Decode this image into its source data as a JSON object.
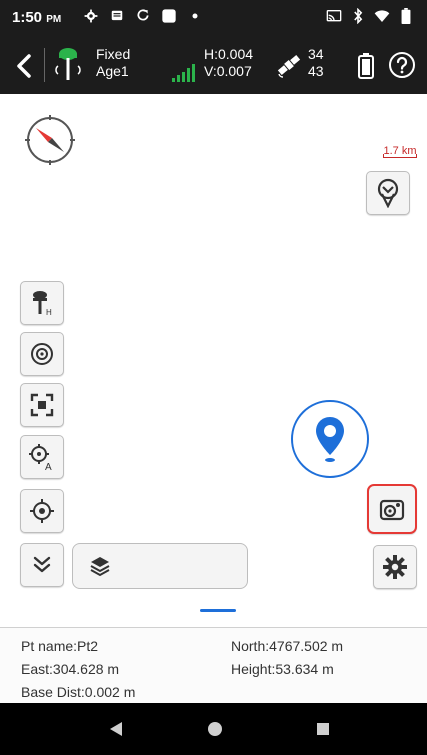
{
  "status_bar": {
    "time": "1:50",
    "ampm": "PM",
    "left_icons": [
      "settings-icon",
      "message-icon",
      "sync-icon",
      "app-square-icon",
      "notification-dot-icon"
    ],
    "right_icons": [
      "cast-icon",
      "bluetooth-icon",
      "wifi-icon",
      "battery-icon"
    ]
  },
  "toolbar": {
    "fix_status": "Fixed",
    "age": "Age1",
    "h_precision": "H:0.004",
    "v_precision": "V:0.007",
    "sat_used": "34",
    "sat_visible": "43",
    "colors": {
      "gnss_icon": "#2bb34b",
      "signal_bars": "#2bb34b",
      "accent": "#1e6fd9"
    }
  },
  "map": {
    "scale_label": "1.7 km",
    "scale_color": "#c62828",
    "left_tools": [
      {
        "name": "antenna-height-button",
        "icon": "antenna-height-icon"
      },
      {
        "name": "record-point-button",
        "icon": "target-record-icon"
      },
      {
        "name": "full-extent-button",
        "icon": "full-extent-icon"
      },
      {
        "name": "auto-collect-button",
        "icon": "auto-collect-icon"
      },
      {
        "name": "center-location-button",
        "icon": "crosshair-icon"
      },
      {
        "name": "collapse-tools-button",
        "icon": "double-chevron-down-icon"
      }
    ],
    "layer_icon": "layers-icon",
    "highlight_color": "#e53935"
  },
  "info_panel": {
    "pt_name": "Pt name:Pt2",
    "north": "North:4767.502 m",
    "east": "East:304.628 m",
    "height": "Height:53.634 m",
    "base_dist": "Base Dist:0.002 m"
  },
  "nav_bar": {
    "buttons": [
      "back-triangle-icon",
      "home-circle-icon",
      "recents-square-icon"
    ]
  }
}
